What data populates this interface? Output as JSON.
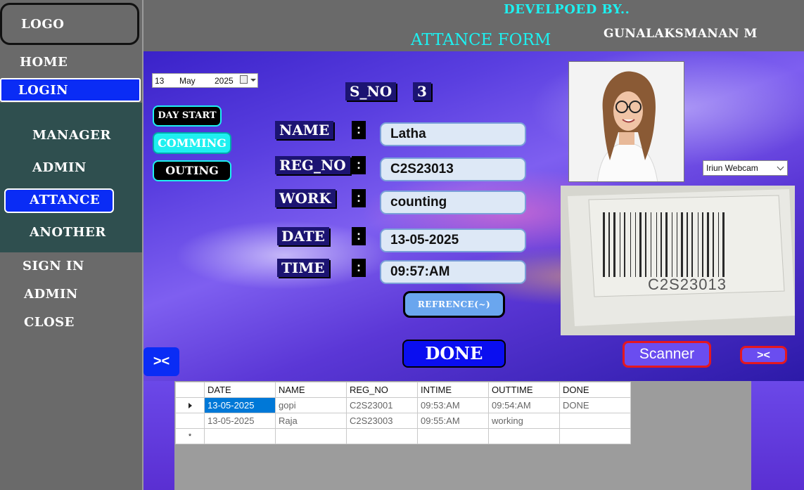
{
  "sidebar": {
    "logo": "LOGO",
    "items": [
      "HOME",
      "LOGIN"
    ],
    "sub_items": [
      "MANAGER",
      "ADMIN",
      "ATTANCE",
      "ANOTHER"
    ],
    "bottom_items": [
      "SIGN IN",
      "ADMIN",
      "CLOSE"
    ]
  },
  "header": {
    "developed_by": "DEVELPOED BY..",
    "title": "ATTANCE FORM",
    "developer_name": "GUNALAKSMANAN M"
  },
  "date_picker": {
    "day": "13",
    "month": "May",
    "year": "2025"
  },
  "mode_buttons": {
    "day_start": "DAY START",
    "comming": "COMMING",
    "outing": "OUTING"
  },
  "sno": {
    "label": "S_NO",
    "value": "3"
  },
  "form": {
    "name_label": "NAME",
    "name_value": "Latha",
    "regno_label": "REG_NO",
    "regno_value": "C2S23013",
    "work_label": "WORK",
    "work_value": "counting",
    "date_label": "DATE",
    "date_value": "13-05-2025",
    "time_label": "TIME",
    "time_value": "09:57:AM",
    "colon": ":"
  },
  "buttons": {
    "reference": "REFRENCE(~)",
    "done": "DONE",
    "scanner": "Scanner",
    "collapse_left": "><",
    "collapse_right": "><"
  },
  "webcam": {
    "selected": "Iriun Webcam"
  },
  "barcode_text": "C2S23013",
  "grid": {
    "columns": [
      "DATE",
      "NAME",
      "REG_NO",
      "INTIME",
      "OUTTIME",
      "DONE"
    ],
    "rows": [
      [
        "13-05-2025",
        "gopi",
        "C2S23001",
        "09:53:AM",
        "09:54:AM",
        "DONE"
      ],
      [
        "13-05-2025",
        "Raja",
        "C2S23003",
        "09:55:AM",
        "working",
        ""
      ]
    ]
  }
}
